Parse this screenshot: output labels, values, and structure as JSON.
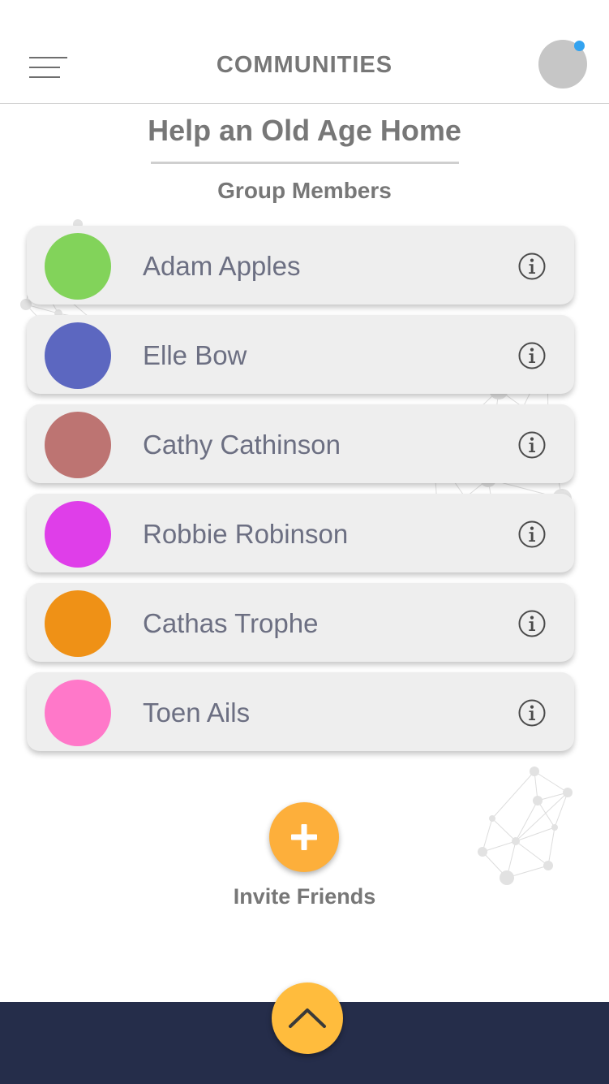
{
  "header": {
    "title": "COMMUNITIES",
    "menu_icon": "hamburger-menu-icon",
    "profile_icon": "avatar",
    "has_notification": true
  },
  "community": {
    "title": "Help an Old Age Home",
    "section_label": "Group Members"
  },
  "members": [
    {
      "name": "Adam Apples",
      "color": "#82d35a"
    },
    {
      "name": "Elle Bow",
      "color": "#5c67c0"
    },
    {
      "name": "Cathy Cathinson",
      "color": "#bd7472"
    },
    {
      "name": "Robbie Robinson",
      "color": "#df3ee9"
    },
    {
      "name": "Cathas Trophe",
      "color": "#ef9116"
    },
    {
      "name": "Toen Ails",
      "color": "#ff78c9"
    }
  ],
  "invite": {
    "label": "Invite Friends",
    "icon": "plus-icon"
  },
  "footer": {
    "icon": "chevron-up-icon"
  },
  "colors": {
    "accent": "#fdaf3b",
    "footer": "#252d4a",
    "notification": "#33a3f0",
    "card_background": "#eeeeee"
  }
}
